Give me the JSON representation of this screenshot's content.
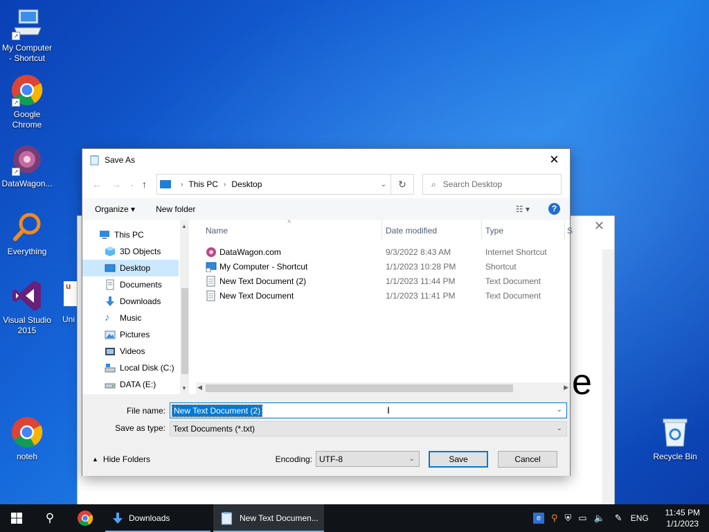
{
  "desktop": {
    "icons": [
      {
        "label": "My Computer - Shortcut"
      },
      {
        "label": "Google Chrome"
      },
      {
        "label": "DataWagon..."
      },
      {
        "label": "Everything"
      },
      {
        "label": "Visual Studio 2015"
      },
      {
        "label": "Uni"
      },
      {
        "label": "noteh"
      },
      {
        "label": "Recycle Bin"
      }
    ]
  },
  "background_window": {
    "visible_text": "e"
  },
  "dialog": {
    "title": "Save As",
    "close_glyph": "✕",
    "address": {
      "segments": [
        "This PC",
        "Desktop"
      ]
    },
    "search_placeholder": "Search Desktop",
    "toolbar": {
      "organize": "Organize ▾",
      "new_folder": "New folder",
      "view_glyph": "☷ ▾",
      "help": "?"
    },
    "nav": [
      {
        "label": "This PC",
        "icon": "computer-icon"
      },
      {
        "label": "3D Objects",
        "icon": "cube-icon"
      },
      {
        "label": "Desktop",
        "icon": "desktop-icon",
        "selected": true
      },
      {
        "label": "Documents",
        "icon": "document-icon"
      },
      {
        "label": "Downloads",
        "icon": "download-icon"
      },
      {
        "label": "Music",
        "icon": "music-icon"
      },
      {
        "label": "Pictures",
        "icon": "pictures-icon"
      },
      {
        "label": "Videos",
        "icon": "video-icon"
      },
      {
        "label": "Local Disk (C:)",
        "icon": "disk-icon"
      },
      {
        "label": "DATA (E:)",
        "icon": "drive-icon"
      }
    ],
    "columns": {
      "name": "Name",
      "date": "Date modified",
      "type": "Type",
      "extra": "S"
    },
    "files": [
      {
        "name": "DataWagon.com",
        "date": "9/3/2022 8:43 AM",
        "type": "Internet Shortcut",
        "icon": "internet-shortcut-icon"
      },
      {
        "name": "My Computer - Shortcut",
        "date": "1/1/2023 10:28 PM",
        "type": "Shortcut",
        "icon": "shortcut-icon"
      },
      {
        "name": "New Text Document (2)",
        "date": "1/1/2023 11:44 PM",
        "type": "Text Document",
        "icon": "text-file-icon"
      },
      {
        "name": "New Text Document",
        "date": "1/1/2023 11:41 PM",
        "type": "Text Document",
        "icon": "text-file-icon"
      }
    ],
    "file_name_label": "File name:",
    "file_name_value": "New Text Document (2)",
    "save_type_label": "Save as type:",
    "save_type_value": "Text Documents (*.txt)",
    "hide_folders": "Hide Folders",
    "encoding_label": "Encoding:",
    "encoding_value": "UTF-8",
    "save_button": "Save",
    "cancel_button": "Cancel"
  },
  "taskbar": {
    "downloads_label": "Downloads",
    "notepad_label": "New Text Documen...",
    "language": "ENG",
    "time": "11:45 PM",
    "date": "1/1/2023"
  },
  "colors": {
    "accent": "#0078d7",
    "selection": "#cce8ff",
    "taskbar": "#101419"
  }
}
